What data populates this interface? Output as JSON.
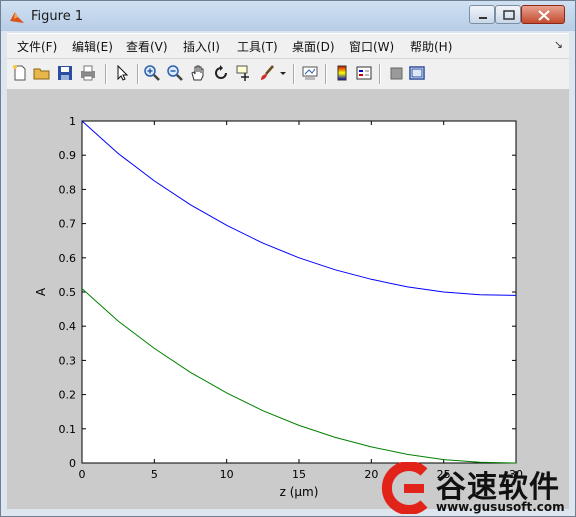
{
  "window": {
    "title": "Figure 1"
  },
  "menu": [
    "文件(F)",
    "编辑(E)",
    "查看(V)",
    "插入(I)",
    "工具(T)",
    "桌面(D)",
    "窗口(W)",
    "帮助(H)"
  ],
  "toolbar_icons": [
    "new-figure-icon",
    "open-file-icon",
    "save-icon",
    "print-icon",
    "edit-plot-arrow-icon",
    "zoom-in-icon",
    "zoom-out-icon",
    "pan-hand-icon",
    "rotate-3d-icon",
    "data-cursor-icon",
    "brush-icon",
    "brush-dropdown-icon",
    "link-plot-icon",
    "colorbar-icon",
    "legend-icon",
    "hide-plot-tools-icon",
    "show-plot-tools-icon"
  ],
  "chart_data": {
    "type": "line",
    "xlabel": "z (μm)",
    "ylabel": "A",
    "xlim": [
      0,
      30
    ],
    "ylim": [
      0,
      1
    ],
    "xticks": [
      "0",
      "5",
      "10",
      "15",
      "20",
      "25",
      "30"
    ],
    "yticks": [
      "0",
      "0.1",
      "0.2",
      "0.3",
      "0.4",
      "0.5",
      "0.6",
      "0.7",
      "0.8",
      "0.9",
      "1"
    ],
    "grid": false,
    "series": [
      {
        "color": "#0000ff",
        "x": [
          0,
          2.5,
          5,
          7.5,
          10,
          12.5,
          15,
          17.5,
          20,
          22.5,
          25,
          27.5,
          30
        ],
        "y": [
          1.0,
          0.905,
          0.825,
          0.755,
          0.695,
          0.643,
          0.6,
          0.565,
          0.537,
          0.515,
          0.5,
          0.492,
          0.49
        ]
      },
      {
        "color": "#008000",
        "x": [
          0,
          2.5,
          5,
          7.5,
          10,
          12.5,
          15,
          17.5,
          20,
          22.5,
          25,
          27.5,
          30
        ],
        "y": [
          0.51,
          0.415,
          0.335,
          0.265,
          0.205,
          0.153,
          0.11,
          0.075,
          0.047,
          0.025,
          0.01,
          0.002,
          0.0
        ]
      }
    ]
  },
  "watermark": {
    "text": "谷速软件",
    "url": "www.gususoft.com"
  }
}
